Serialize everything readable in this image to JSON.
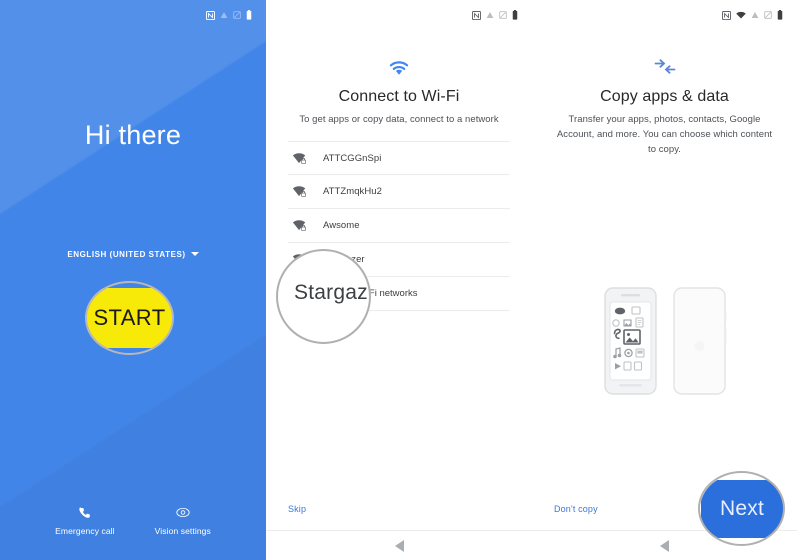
{
  "screen1": {
    "name": "welcome-screen",
    "background_color": "#4285e8",
    "statusbar": {
      "icons": [
        "nfc-icon",
        "signal-icon",
        "network-icon",
        "battery-icon"
      ]
    },
    "greeting": "Hi there",
    "language": {
      "value": "ENGLISH (UNITED STATES)",
      "caret": "chevron-down-icon"
    },
    "start_button": {
      "label": "START",
      "color": "#f7e908",
      "text_color": "#1b1b1b",
      "magnified": true
    },
    "footer": [
      {
        "icon": "phone-icon",
        "label": "Emergency call"
      },
      {
        "icon": "eye-icon",
        "label": "Vision settings"
      }
    ]
  },
  "screen2": {
    "name": "connect-to-wifi-screen",
    "statusbar": {
      "icons": [
        "nfc-icon",
        "signal-icon",
        "network-icon",
        "battery-icon"
      ]
    },
    "hero_icon": "wifi-icon",
    "hero_icon_color": "#4285f4",
    "title": "Connect to Wi-Fi",
    "subtitle": "To get apps or copy data, connect to a network",
    "networks": [
      {
        "ssid": "ATTCGGnSpi",
        "icon": "wifi-lock-icon"
      },
      {
        "ssid": "ATTZmqkHu2",
        "icon": "wifi-lock-icon"
      },
      {
        "ssid": "Awsome",
        "icon": "wifi-lock-icon"
      },
      {
        "ssid": "Stargazer",
        "icon": "wifi-lock-icon"
      }
    ],
    "magnified_network": "Stargaz",
    "add_network": {
      "icon": "plus-icon",
      "label": "See all Wi-Fi networks"
    },
    "skip_label": "Skip",
    "navbar": {
      "back": "back-triangle-icon"
    }
  },
  "screen3": {
    "name": "copy-apps-and-data-screen",
    "statusbar": {
      "icons": [
        "nfc-icon",
        "wifi-icon",
        "signal-icon",
        "network-icon",
        "battery-icon"
      ]
    },
    "hero_icon": "transfer-arrows-icon",
    "hero_icon_color": "#5b86d4",
    "title": "Copy apps & data",
    "subtitle": "Transfer your apps, photos, contacts, Google Account, and more. You can choose which content to copy.",
    "illustration": "two-phones-transfer-illustration",
    "dont_copy_label": "Don't copy",
    "next_button": {
      "label": "Next",
      "color": "#2a6fdb",
      "text_color": "#e9f0fd",
      "magnified": true
    },
    "navbar": {
      "back": "back-triangle-icon"
    }
  }
}
